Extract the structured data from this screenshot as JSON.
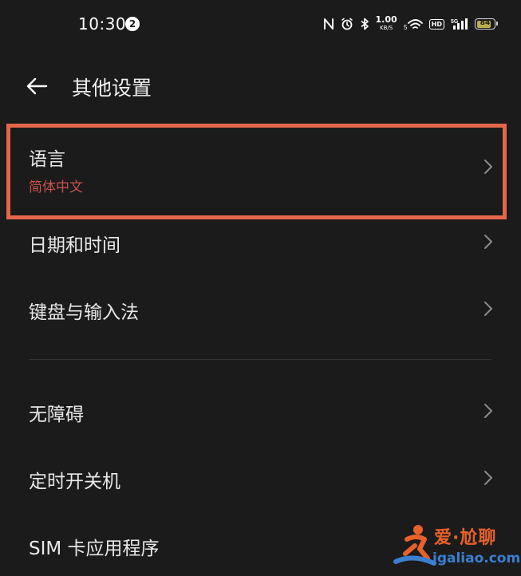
{
  "status_bar": {
    "time": "10:30",
    "notification_count": "2",
    "net_speed_value": "1.00",
    "net_speed_unit": "KB/S",
    "hd_label": "HD",
    "battery_level": "84",
    "battery_fraction": 0.84,
    "icons": [
      "nfc-icon",
      "alarm-icon",
      "bluetooth-icon",
      "wifi-icon",
      "hd-icon",
      "5g-signal-icon",
      "battery-icon"
    ]
  },
  "header": {
    "back_icon": "back-arrow-icon",
    "title": "其他设置"
  },
  "settings": [
    {
      "label": "语言",
      "value": "简体中文",
      "highlighted": true
    },
    {
      "label": "日期和时间"
    },
    {
      "label": "键盘与输入法"
    },
    {
      "label": "无障碍"
    },
    {
      "label": "定时开关机"
    },
    {
      "label": "SIM 卡应用程序"
    }
  ],
  "colors": {
    "background": "#1b1b1b",
    "highlight_border": "#e5664b",
    "subtitle": "#c8524e",
    "chevron": "#8a8a8a"
  },
  "watermark": {
    "line1": "爱·尬聊",
    "line2": "igaliao.com"
  }
}
